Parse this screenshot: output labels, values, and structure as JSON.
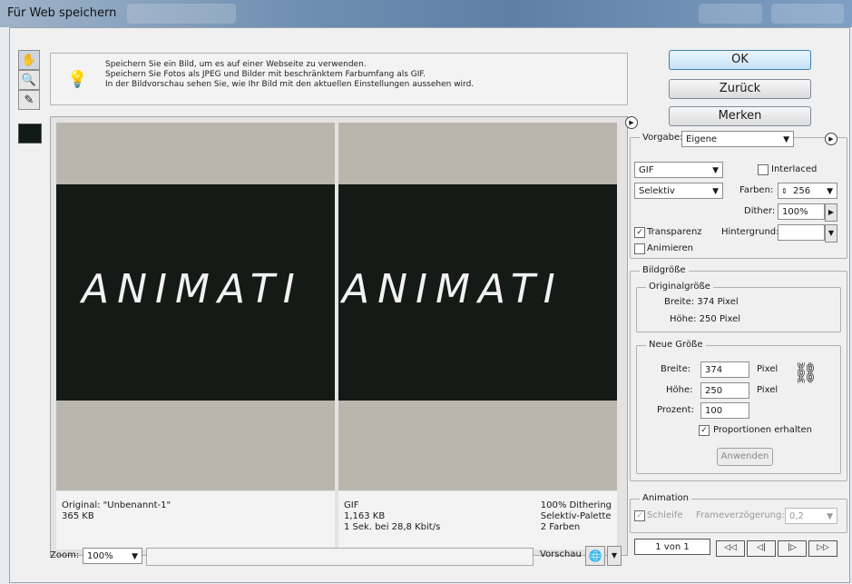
{
  "window": {
    "title": "Für Web speichern"
  },
  "tools": [
    {
      "icon": "hand-icon",
      "glyph": "✋"
    },
    {
      "icon": "zoom-icon",
      "glyph": "🔍"
    },
    {
      "icon": "eyedropper-icon",
      "glyph": "✎"
    }
  ],
  "info": {
    "lines": [
      "Speichern Sie ein Bild, um es auf einer Webseite zu verwenden.",
      "Speichern Sie Fotos als JPEG und Bilder mit beschränktem Farbumfang als GIF.",
      "In der Bildvorschau sehen Sie, wie Ihr Bild mit den aktuellen Einstellungen aussehen wird."
    ]
  },
  "preview": {
    "art_text": "ANIMATI",
    "original": {
      "name": "Original: \"Unbenannt-1\"",
      "size": "365 KB"
    },
    "optimized": {
      "format": "GIF",
      "size": "1,163 KB",
      "time": "1 Sek. bei 28,8 Kbit/s",
      "dither": "100% Dithering",
      "palette": "Selektiv-Palette",
      "colors": "2 Farben"
    }
  },
  "zoom": {
    "label": "Zoom:",
    "value": "100%"
  },
  "preview_in": {
    "label": "Vorschau in:"
  },
  "buttons": {
    "ok": "OK",
    "back": "Zurück",
    "remember": "Merken"
  },
  "settings": {
    "preset_label": "Vorgabe:",
    "preset_value": "Eigene",
    "format": "GIF",
    "interlaced_label": "Interlaced",
    "interlaced": false,
    "reduction": "Selektiv",
    "colors_label": "Farben:",
    "colors_value": "256",
    "dither_label": "Dither:",
    "dither_value": "100%",
    "transparency_label": "Transparenz",
    "transparency": true,
    "matte_label": "Hintergrund:",
    "animate_label": "Animieren",
    "animate": false
  },
  "image_size": {
    "legend": "Bildgröße",
    "original_legend": "Originalgröße",
    "orig_width": "Breite: 374 Pixel",
    "orig_height": "Höhe: 250 Pixel",
    "new_legend": "Neue Größe",
    "width_label": "Breite:",
    "width_value": "374",
    "height_label": "Höhe:",
    "height_value": "250",
    "unit": "Pixel",
    "percent_label": "Prozent:",
    "percent_value": "100",
    "constrain_label": "Proportionen erhalten",
    "constrain": true,
    "apply": "Anwenden"
  },
  "animation": {
    "legend": "Animation",
    "loop_label": "Schleife",
    "delay_label": "Frameverzögerung:",
    "delay_value": "0,2",
    "frame_counter": "1 von 1"
  }
}
